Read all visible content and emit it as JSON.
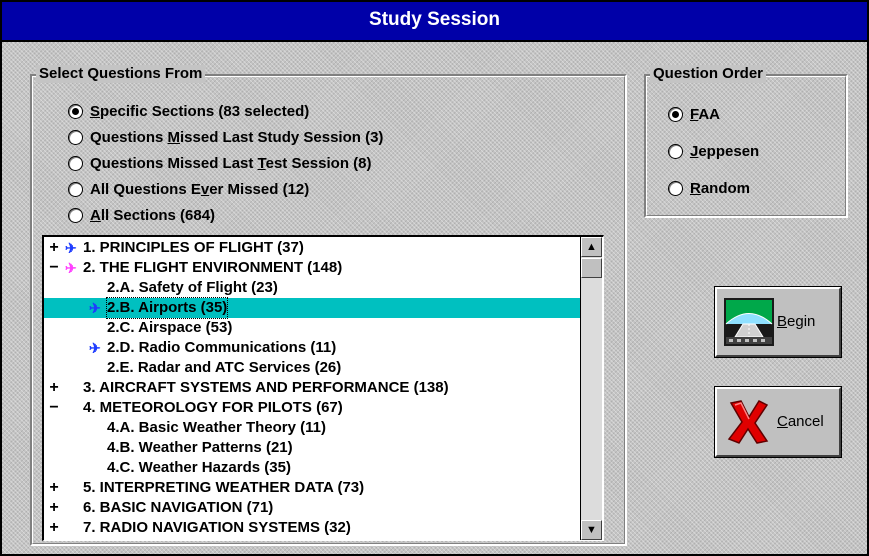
{
  "window": {
    "title": "Study Session"
  },
  "select_group": {
    "legend": "Select Questions From",
    "options": [
      {
        "pre": "",
        "mnemonic": "S",
        "post": "pecific Sections  (83 selected)",
        "selected": true
      },
      {
        "pre": "Questions ",
        "mnemonic": "M",
        "post": "issed Last Study Session  (3)",
        "selected": false
      },
      {
        "pre": "Questions Missed Last ",
        "mnemonic": "T",
        "post": "est Session  (8)",
        "selected": false
      },
      {
        "pre": "All Questions E",
        "mnemonic": "v",
        "post": "er Missed  (12)",
        "selected": false
      },
      {
        "pre": "",
        "mnemonic": "A",
        "post": "ll Sections  (684)",
        "selected": false
      }
    ]
  },
  "order_group": {
    "legend": "Question Order",
    "options": [
      {
        "mnemonic": "F",
        "post": "AA",
        "selected": true
      },
      {
        "mnemonic": "J",
        "post": "eppesen",
        "selected": false
      },
      {
        "mnemonic": "R",
        "post": "andom",
        "selected": false
      }
    ]
  },
  "tree": {
    "items": [
      {
        "expander": "+",
        "arrow": "blue",
        "text": "1. PRINCIPLES OF FLIGHT (37)",
        "level": 0,
        "selected": false
      },
      {
        "expander": "−",
        "arrow": "pink",
        "text": "2. THE FLIGHT ENVIRONMENT (148)",
        "level": 0,
        "selected": false
      },
      {
        "expander": "",
        "arrow": "",
        "text": "2.A. Safety of Flight (23)",
        "level": 1,
        "selected": false
      },
      {
        "expander": "",
        "arrow": "blue",
        "text": "2.B. Airports (35)",
        "level": 1,
        "selected": true
      },
      {
        "expander": "",
        "arrow": "",
        "text": "2.C. Airspace (53)",
        "level": 1,
        "selected": false
      },
      {
        "expander": "",
        "arrow": "blue",
        "text": "2.D. Radio Communications (11)",
        "level": 1,
        "selected": false
      },
      {
        "expander": "",
        "arrow": "",
        "text": "2.E. Radar and ATC Services (26)",
        "level": 1,
        "selected": false
      },
      {
        "expander": "+",
        "arrow": "",
        "text": "3. AIRCRAFT SYSTEMS AND PERFORMANCE (138)",
        "level": 0,
        "selected": false
      },
      {
        "expander": "−",
        "arrow": "",
        "text": "4. METEOROLOGY FOR PILOTS (67)",
        "level": 0,
        "selected": false
      },
      {
        "expander": "",
        "arrow": "",
        "text": "4.A. Basic Weather Theory (11)",
        "level": 1,
        "selected": false
      },
      {
        "expander": "",
        "arrow": "",
        "text": "4.B. Weather Patterns (21)",
        "level": 1,
        "selected": false
      },
      {
        "expander": "",
        "arrow": "",
        "text": "4.C. Weather Hazards (35)",
        "level": 1,
        "selected": false
      },
      {
        "expander": "+",
        "arrow": "",
        "text": "5. INTERPRETING WEATHER DATA (73)",
        "level": 0,
        "selected": false
      },
      {
        "expander": "+",
        "arrow": "",
        "text": "6. BASIC NAVIGATION (71)",
        "level": 0,
        "selected": false
      },
      {
        "expander": "+",
        "arrow": "",
        "text": "7. RADIO NAVIGATION SYSTEMS (32)",
        "level": 0,
        "selected": false
      }
    ],
    "scroll_up_glyph": "▲",
    "scroll_down_glyph": "▼"
  },
  "buttons": {
    "begin": {
      "mnemonic": "B",
      "rest": "egin",
      "icon": "runway-icon"
    },
    "cancel": {
      "mnemonic": "C",
      "rest": "ancel",
      "icon": "red-x-icon"
    }
  },
  "colors": {
    "title_bar": "#0000a8",
    "selection": "#00c0c0",
    "arrow_blue": "#1e3cff",
    "arrow_pink": "#ff40ff"
  }
}
